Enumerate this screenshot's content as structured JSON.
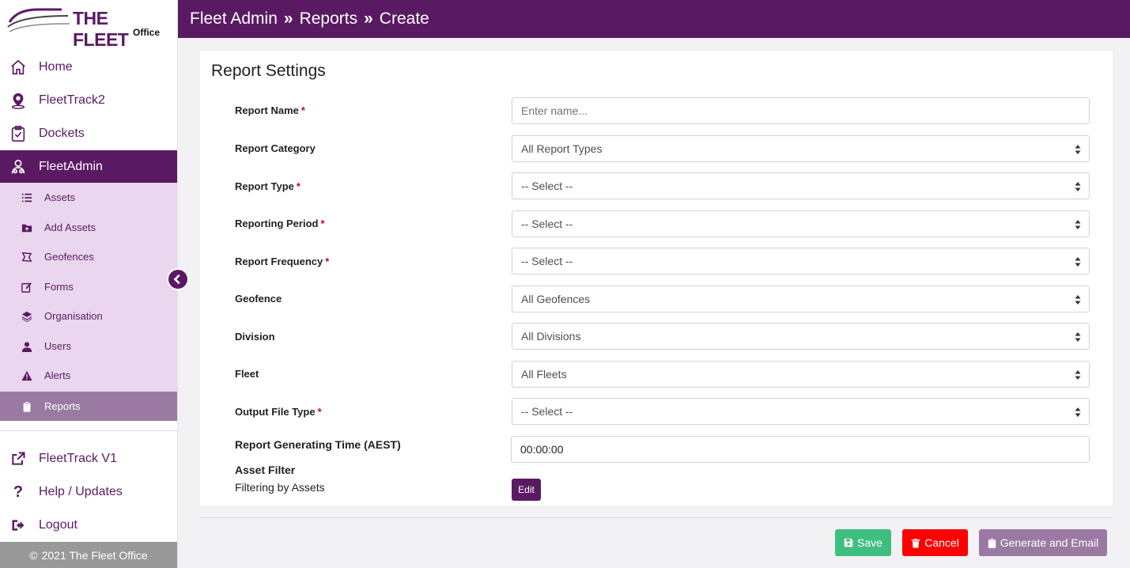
{
  "brand": {
    "name": "THE FLEET",
    "sub": "Office"
  },
  "colors": {
    "brand": "#5a1a63",
    "save": "#3fbf7f",
    "cancel": "#ff0000",
    "generate": "#9a7aa3"
  },
  "header": {
    "crumbs": [
      "Fleet Admin",
      "Reports",
      "Create"
    ]
  },
  "nav": {
    "home": "Home",
    "fleettrack2": "FleetTrack2",
    "dockets": "Dockets",
    "fleetadmin": "FleetAdmin",
    "sub": {
      "assets": "Assets",
      "add_assets": "Add Assets",
      "geofences": "Geofences",
      "forms": "Forms",
      "organisation": "Organisation",
      "users": "Users",
      "alerts": "Alerts",
      "reports": "Reports"
    },
    "fleettrack_v1": "FleetTrack V1",
    "help": "Help / Updates",
    "logout": "Logout"
  },
  "footer": {
    "text": "2021 The Fleet Office"
  },
  "form": {
    "title": "Report Settings",
    "report_name": {
      "label": "Report Name",
      "placeholder": "Enter name..."
    },
    "report_category": {
      "label": "Report Category",
      "value": "All Report Types"
    },
    "report_type": {
      "label": "Report Type",
      "value": "-- Select --"
    },
    "reporting_period": {
      "label": "Reporting Period",
      "value": "-- Select --"
    },
    "report_frequency": {
      "label": "Report Frequency",
      "value": "-- Select --"
    },
    "geofence": {
      "label": "Geofence",
      "value": "All Geofences"
    },
    "division": {
      "label": "Division",
      "value": "All Divisions"
    },
    "fleet": {
      "label": "Fleet",
      "value": "All Fleets"
    },
    "output_file_type": {
      "label": "Output File Type",
      "value": "-- Select --"
    },
    "generating_time": {
      "label": "Report Generating Time (AEST)",
      "value": "00:00:00"
    },
    "asset_filter": {
      "label": "Asset Filter",
      "sub": "Filtering by Assets",
      "edit": "Edit"
    },
    "required_mark": "*"
  },
  "actions": {
    "save": "Save",
    "cancel": "Cancel",
    "generate": "Generate and Email"
  }
}
